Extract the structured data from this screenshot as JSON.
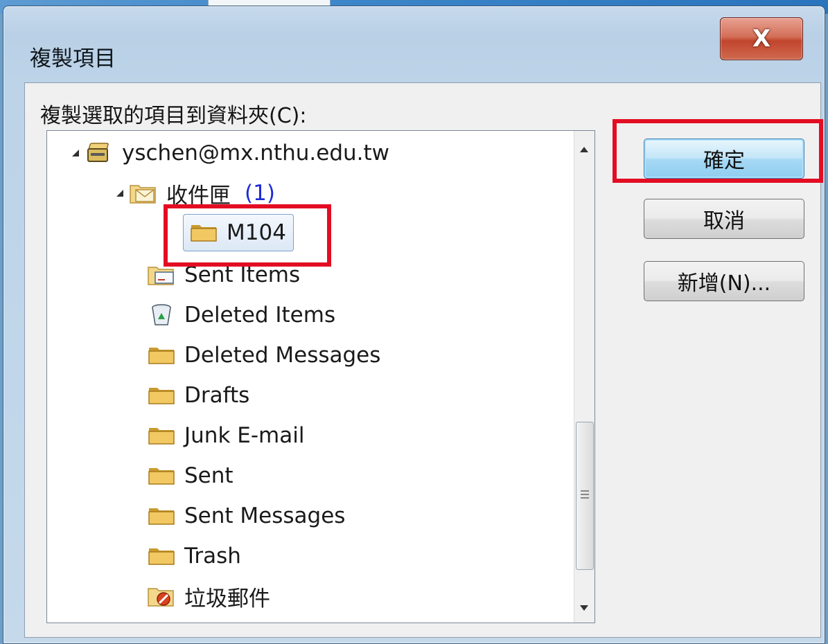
{
  "dialog": {
    "title": "複製項目",
    "close_label": "X",
    "prompt": "複製選取的項目到資料夾(C):"
  },
  "tree": {
    "items": [
      {
        "label": "yschen@mx.nthu.edu.tw",
        "icon": "mailbox-icon",
        "expanded": true
      },
      {
        "label": "收件匣",
        "count": "(1)",
        "icon": "inbox-icon",
        "expanded": true
      },
      {
        "label": "M104",
        "icon": "folder-icon",
        "selected": true
      },
      {
        "label": "Sent Items",
        "icon": "sent-items-icon"
      },
      {
        "label": "Deleted Items",
        "icon": "recycle-bin-icon"
      },
      {
        "label": "Deleted Messages",
        "icon": "folder-icon"
      },
      {
        "label": "Drafts",
        "icon": "folder-icon"
      },
      {
        "label": "Junk E-mail",
        "icon": "folder-icon"
      },
      {
        "label": "Sent",
        "icon": "folder-icon"
      },
      {
        "label": "Sent Messages",
        "icon": "folder-icon"
      },
      {
        "label": "Trash",
        "icon": "folder-icon"
      },
      {
        "label": "垃圾郵件",
        "icon": "junk-folder-icon"
      }
    ]
  },
  "buttons": {
    "ok": "確定",
    "cancel": "取消",
    "new": "新增(N)..."
  },
  "colors": {
    "highlight": "#e30d23",
    "count": "#1d2bd7",
    "primary_button": "#a7d9f5"
  }
}
